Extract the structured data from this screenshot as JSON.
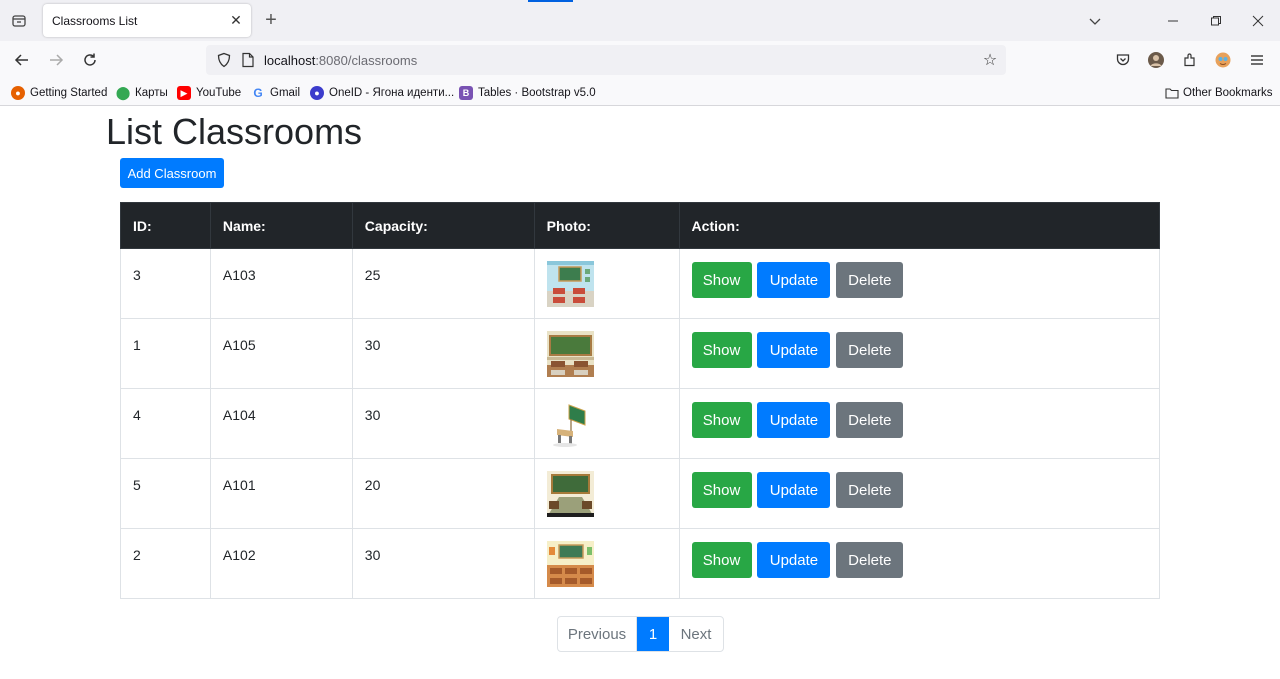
{
  "browser": {
    "tab_title": "Classrooms List",
    "url_host": "localhost",
    "url_rest": ":8080/classrooms",
    "bookmarks": [
      {
        "label": "Getting Started",
        "icon": "firefox-icon",
        "color": "#e66000"
      },
      {
        "label": "Карты",
        "icon": "maps-pin-icon",
        "color": "#34a853"
      },
      {
        "label": "YouTube",
        "icon": "youtube-icon",
        "color": "#ff0000"
      },
      {
        "label": "Gmail",
        "icon": "google-icon",
        "color": "#4285f4"
      },
      {
        "label": "OneID - Ягона иденти...",
        "icon": "oneid-icon",
        "color": "#3c3ccc"
      },
      {
        "label": "Tables · Bootstrap v5.0",
        "icon": "bootstrap-icon",
        "color": "#7952b3"
      }
    ],
    "other_bookmarks": "Other Bookmarks"
  },
  "page": {
    "title": "List Classrooms",
    "add_button": "Add Classroom"
  },
  "table": {
    "headers": [
      "ID:",
      "Name:",
      "Capacity:",
      "Photo:",
      "Action:"
    ],
    "rows": [
      {
        "id": "3",
        "name": "A103",
        "capacity": "25",
        "photo": "classroom-photo-1"
      },
      {
        "id": "1",
        "name": "A105",
        "capacity": "30",
        "photo": "classroom-photo-2"
      },
      {
        "id": "4",
        "name": "A104",
        "capacity": "30",
        "photo": "classroom-photo-3"
      },
      {
        "id": "5",
        "name": "A101",
        "capacity": "20",
        "photo": "classroom-photo-4"
      },
      {
        "id": "2",
        "name": "A102",
        "capacity": "30",
        "photo": "classroom-photo-5"
      }
    ],
    "actions": {
      "show": "Show",
      "update": "Update",
      "delete": "Delete"
    }
  },
  "pagination": {
    "previous": "Previous",
    "current": "1",
    "next": "Next"
  },
  "colors": {
    "primary": "#007bff",
    "success": "#28a745",
    "secondary": "#6c757d",
    "header_dark": "#212529"
  }
}
